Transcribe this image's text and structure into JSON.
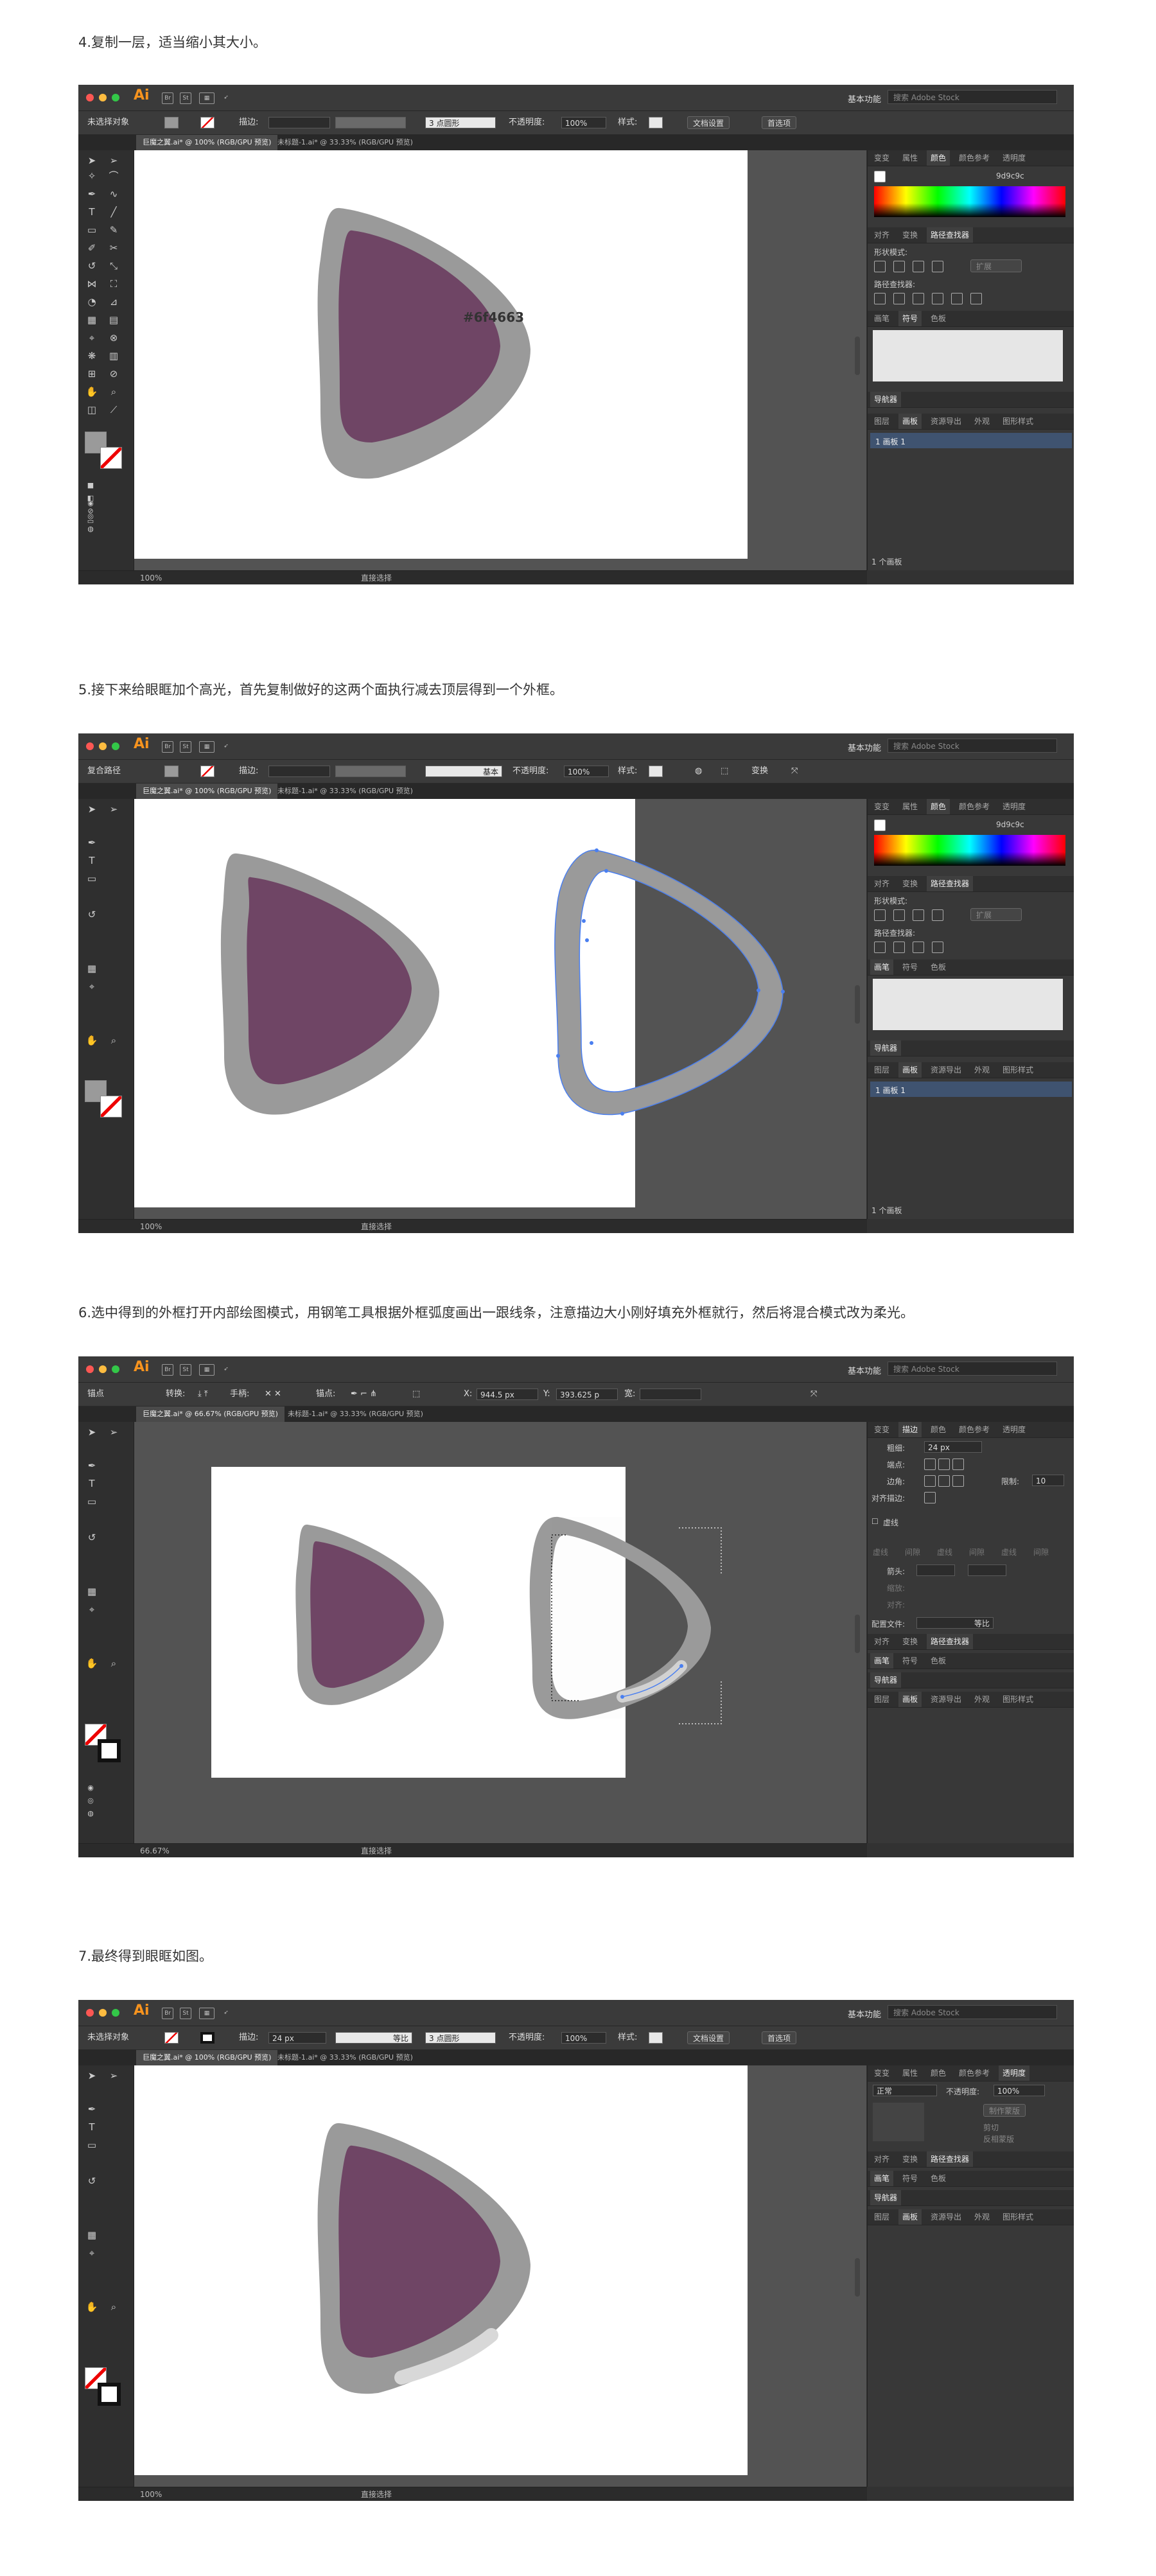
{
  "captions": [
    "4.复制一层，适当缩小其大小。",
    "5.接下来给眼眶加个高光，首先复制做好的这两个面执行减去顶层得到一个外框。",
    "6.选中得到的外框打开内部绘图模式，用钢笔工具根据外框弧度画出一跟线条，注意描边大小刚好填充外框就行，然后将混合模式改为柔光。",
    "7.最终得到眼眶如图。"
  ],
  "app": {
    "logo": "Ai",
    "workspace": "基本功能",
    "stock_placeholder": "搜索 Adobe Stock"
  },
  "colors": {
    "eye_outer": "#9a9a9a",
    "eye_inner": "#6f4565",
    "highlight": "#d8d8d8",
    "selection": "#4a7ff0"
  },
  "shot1": {
    "control": {
      "object": "未选择对象",
      "stroke_label": "描边:",
      "brush": "3 点圆形",
      "opacity_label": "不透明度:",
      "opacity": "100%",
      "style_label": "样式:",
      "doc_setup": "文档设置",
      "prefs": "首选项"
    },
    "tabs": [
      "巨魔之翼.ai* @ 100% (RGB/GPU 预览)",
      "未标题-1.ai* @ 33.33% (RGB/GPU 预览)"
    ],
    "annotation": "#6f4663",
    "panel": {
      "tabs1": [
        "变变",
        "属性",
        "颜色",
        "颜色参考",
        "透明度"
      ],
      "hex": "9d9c9c",
      "tabs2": [
        "对齐",
        "变换",
        "路径查找器"
      ],
      "shape_modes": "形状模式:",
      "expand": "扩展",
      "pathfinder": "路径查找器:",
      "tabs3": [
        "画笔",
        "符号",
        "色板"
      ],
      "navigator": "导航器",
      "tabs4": [
        "图层",
        "画板",
        "资源导出",
        "外观",
        "图形样式"
      ],
      "artboard_row": "1    画板 1",
      "footer": "1 个画板"
    },
    "status": {
      "zoom": "100%",
      "tool": "直接选择"
    }
  },
  "shot2": {
    "control": {
      "object": "复合路径",
      "stroke_label": "描边:",
      "brush": "基本",
      "opacity_label": "不透明度:",
      "opacity": "100%",
      "style_label": "样式:",
      "transform": "变换"
    },
    "tabs": [
      "巨魔之翼.ai* @ 100% (RGB/GPU 预览)",
      "未标题-1.ai* @ 33.33% (RGB/GPU 预览)"
    ],
    "panel": {
      "tabs1": [
        "变变",
        "属性",
        "颜色",
        "颜色参考",
        "透明度"
      ],
      "hex": "9d9c9c",
      "tabs2": [
        "对齐",
        "变换",
        "路径查找器"
      ],
      "shape_modes": "形状模式:",
      "expand": "扩展",
      "pathfinder": "路径查找器:",
      "tabs3": [
        "画笔",
        "符号",
        "色板"
      ],
      "navigator": "导航器",
      "tabs4": [
        "图层",
        "画板",
        "资源导出",
        "外观",
        "图形样式"
      ],
      "artboard_row": "1    画板 1",
      "footer": "1 个画板"
    },
    "status": {
      "zoom": "100%",
      "tool": "直接选择"
    }
  },
  "shot3": {
    "control": {
      "object": "锚点",
      "convert": "转换:",
      "handle": "手柄:",
      "anchor": "锚点:",
      "x_label": "X:",
      "x": "944.5 px",
      "y_label": "Y:",
      "y": "393.625 p",
      "w_label": "宽:"
    },
    "tabs": [
      "巨魔之翼.ai* @ 66.67% (RGB/GPU 预览)",
      "未标题-1.ai* @ 33.33% (RGB/GPU 预览)"
    ],
    "panel": {
      "tabs1": [
        "变变",
        "描边",
        "颜色",
        "颜色参考",
        "透明度"
      ],
      "weight_label": "粗细:",
      "weight": "24 px",
      "cap_label": "端点:",
      "corner_label": "边角:",
      "limit_label": "限制:",
      "limit": "10",
      "align_label": "对齐描边:",
      "dashed": "虚线",
      "dash_labels": [
        "虚线",
        "间隙",
        "虚线",
        "间隙",
        "虚线",
        "间隙"
      ],
      "arrow_label": "箭头:",
      "scale_label": "缩放:",
      "align2_label": "对齐:",
      "profile_label": "配置文件:",
      "profile": "等比",
      "tabs2": [
        "对齐",
        "变换",
        "路径查找器"
      ],
      "tabs3": [
        "画笔",
        "符号",
        "色板"
      ],
      "navigator": "导航器",
      "tabs4": [
        "图层",
        "画板",
        "资源导出",
        "外观",
        "图形样式"
      ]
    },
    "status": {
      "zoom": "66.67%",
      "tool": "直接选择"
    }
  },
  "shot4": {
    "control": {
      "object": "未选择对象",
      "stroke_label": "描边:",
      "stroke": "24 px",
      "profile": "等比",
      "brush": "3 点圆形",
      "opacity_label": "不透明度:",
      "opacity": "100%",
      "style_label": "样式:",
      "doc_setup": "文档设置",
      "prefs": "首选项"
    },
    "tabs": [
      "巨魔之翼.ai* @ 100% (RGB/GPU 预览)",
      "未标题-1.ai* @ 33.33% (RGB/GPU 预览)"
    ],
    "panel": {
      "tabs1": [
        "变变",
        "属性",
        "颜色",
        "颜色参考",
        "透明度"
      ],
      "blend": "正常",
      "opacity_label": "不透明度:",
      "opacity": "100%",
      "make_mask": "制作蒙版",
      "clip": "剪切",
      "invert": "反相蒙版",
      "tabs2": [
        "对齐",
        "变换",
        "路径查找器"
      ],
      "tabs3": [
        "画笔",
        "符号",
        "色板"
      ],
      "navigator": "导航器",
      "tabs4": [
        "图层",
        "画板",
        "资源导出",
        "外观",
        "图形样式"
      ]
    },
    "status": {
      "zoom": "100%",
      "tool": "直接选择"
    }
  }
}
